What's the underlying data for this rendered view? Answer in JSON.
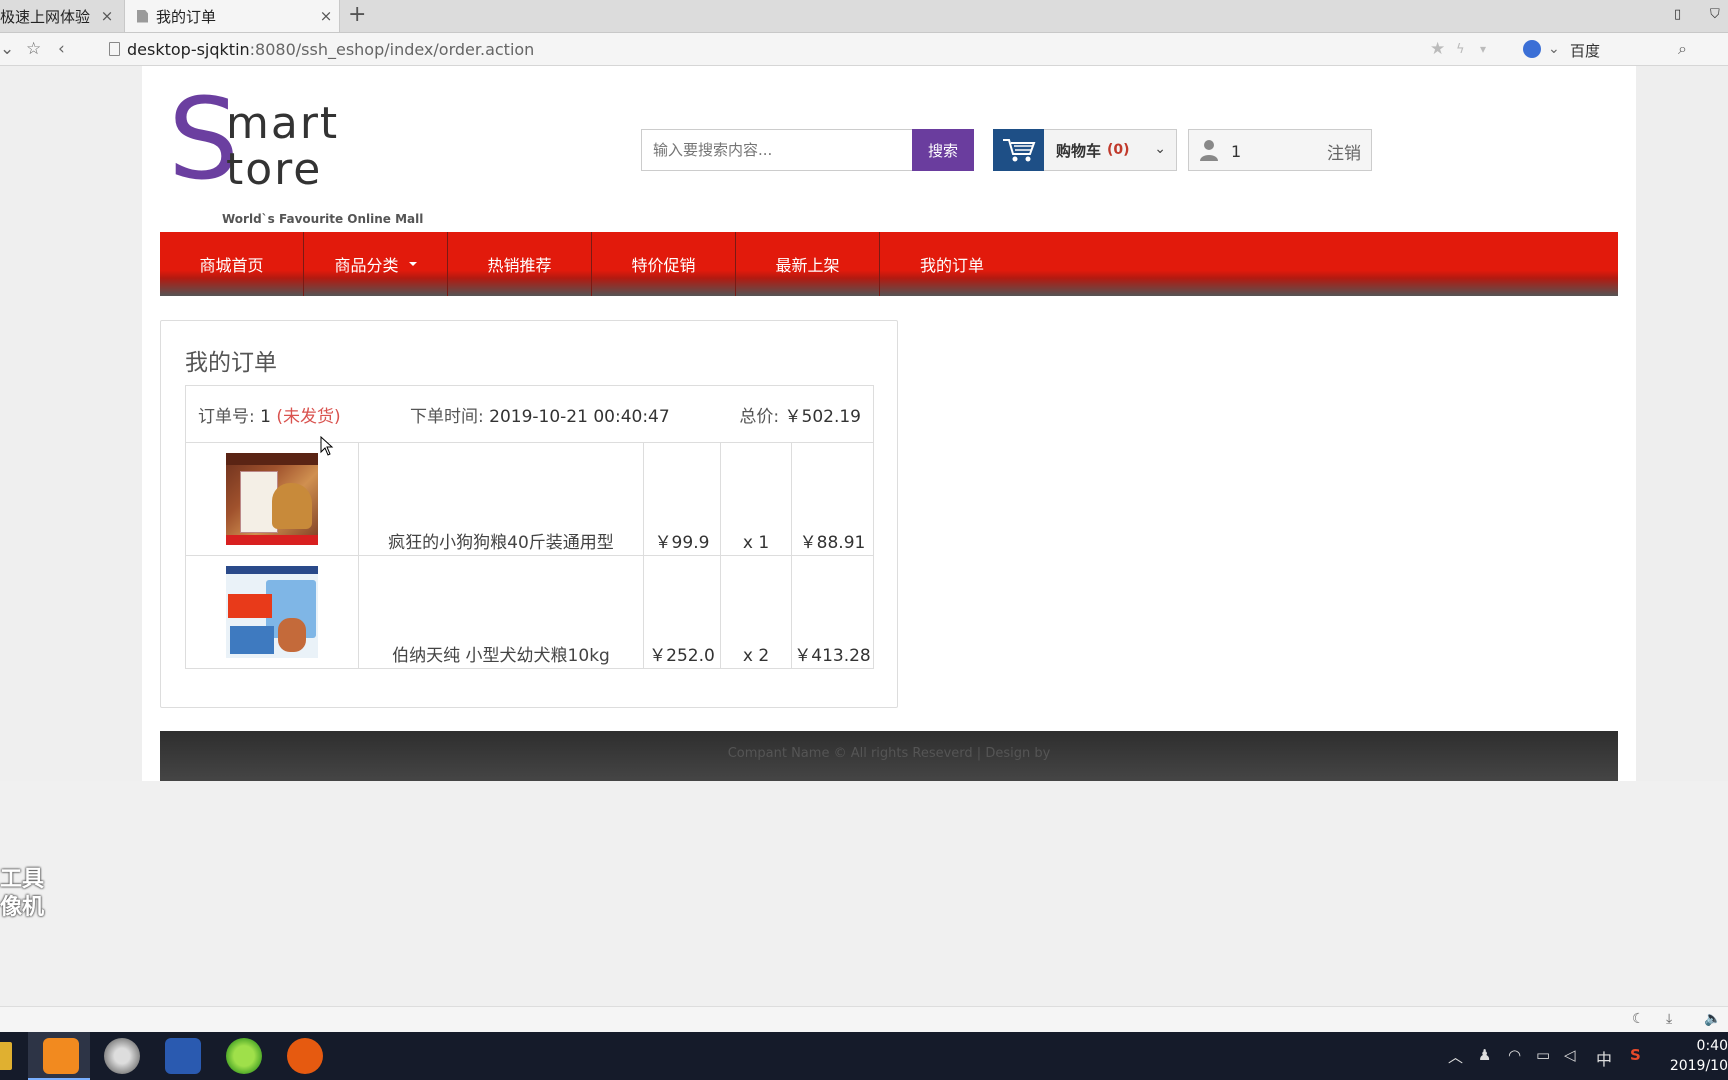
{
  "browser": {
    "tabs": [
      {
        "label": "极速上网体验"
      },
      {
        "label": "我的订单"
      }
    ],
    "new_tab": "+",
    "url_host": "desktop-sjqktin",
    "url_path": ":8080/ssh_eshop/index/order.action",
    "search_engine": "百度"
  },
  "header": {
    "logo": {
      "s": "S",
      "mart": "mart",
      "tore": "tore",
      "tagline": "World`s Favourite Online Mall"
    },
    "search": {
      "placeholder": "输入要搜索内容...",
      "button": "搜索"
    },
    "cart": {
      "label": "购物车",
      "count": "(0)"
    },
    "user": {
      "name": "1",
      "logout": "注销"
    }
  },
  "nav": {
    "items": [
      {
        "label": "商城首页"
      },
      {
        "label": "商品分类"
      },
      {
        "label": "热销推荐"
      },
      {
        "label": "特价促销"
      },
      {
        "label": "最新上架"
      },
      {
        "label": "我的订单"
      }
    ]
  },
  "orders": {
    "title": "我的订单",
    "order": {
      "number_label": "订单号:",
      "number": "1",
      "status": "(未发货)",
      "time_label": "下单时间:",
      "time": "2019-10-21 00:40:47",
      "total_label": "总价:",
      "total": "￥502.19",
      "items": [
        {
          "name": "疯狂的小狗狗粮40斤装通用型",
          "price": "￥99.9",
          "qty": "x 1",
          "subtotal": "￥88.91"
        },
        {
          "name": "伯纳天纯 小型犬幼犬粮10kg",
          "price": "￥252.0",
          "qty": "x 2",
          "subtotal": "￥413.28"
        }
      ]
    }
  },
  "footer": {
    "text": "Compant Name © All rights Reseverd | Design by"
  },
  "watermark": {
    "line1": "工具",
    "line2": "像机"
  },
  "taskbar": {
    "ime": "中",
    "time": "0:40",
    "date": "2019/10"
  },
  "colors": {
    "nav_red": "#e21a0c",
    "brand_purple": "#6b3fa0",
    "cart_blue": "#1e4f86",
    "status_red": "#d9534f"
  }
}
